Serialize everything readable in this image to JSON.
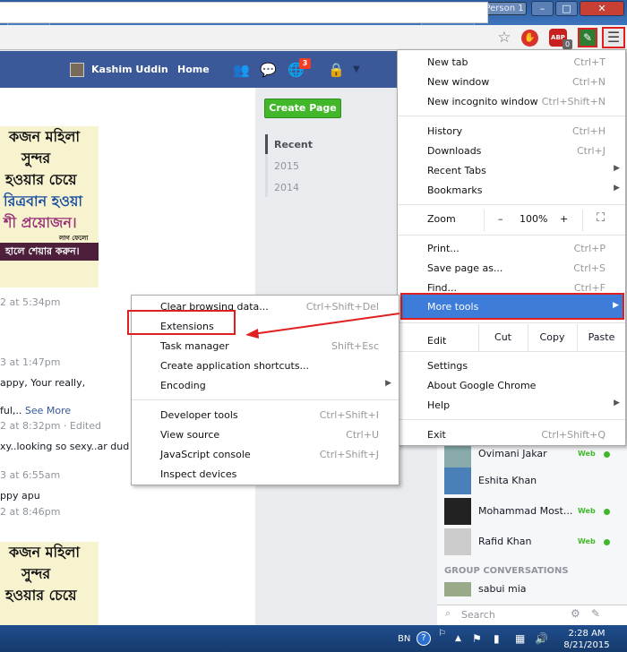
{
  "browser": {
    "profile_name": "Person 1",
    "window_controls": {
      "minimize": "–",
      "maximize": "□",
      "close": "✕"
    },
    "toolbar_icons": [
      "star-icon",
      "stop-extension-icon",
      "adblock-plus-icon",
      "green-extension-icon",
      "menu-icon"
    ],
    "abp_label": "ABP",
    "abp_badge": "0"
  },
  "facebook": {
    "user": "Kashim Uddin",
    "home": "Home",
    "notifications": "3",
    "create_page": "Create Page",
    "years": [
      "Recent",
      "2015",
      "2014"
    ],
    "banner_lines": [
      "কজন মহিলা",
      "সুন্দর",
      "হওয়ার চেয়ে",
      "রিত্রবান হওয়া",
      "শী প্রয়োজন।",
      "লাগ ফেলো",
      "হালে শেয়ার করুন।"
    ],
    "feed": [
      {
        "text": "2 at 5:34pm",
        "type": "time"
      },
      {
        "text": "3 at 1:47pm",
        "type": "time"
      },
      {
        "text": "appy, Your really,",
        "type": "text"
      },
      {
        "text": "ful,..",
        "type": "text",
        "link": "See More"
      },
      {
        "text": "2 at 8:32pm · Edited",
        "type": "time"
      },
      {
        "text": "xy..looking so sexy..ar dud b",
        "type": "text"
      },
      {
        "text": "3 at 6:55am",
        "type": "time"
      },
      {
        "text": "ppy apu",
        "type": "text"
      },
      {
        "text": "2 at 8:46pm",
        "type": "time"
      }
    ],
    "banner2_lines": [
      "কজন মহিলা",
      "সুন্দর",
      "হওয়ার চেয়ে"
    ],
    "chat": {
      "contacts": [
        {
          "name": "Ovimani Jakar",
          "status": "Web"
        },
        {
          "name": "Eshita Khan",
          "status": ""
        },
        {
          "name": "Mohammad Most...",
          "status": "Web"
        },
        {
          "name": "Rafid Khan",
          "status": "Web"
        }
      ],
      "group_header": "GROUP CONVERSATIONS",
      "group_name": "sabui mia",
      "search": "Search"
    }
  },
  "chrome_menu": {
    "items_top": [
      {
        "label": "New tab",
        "shortcut": "Ctrl+T"
      },
      {
        "label": "New window",
        "shortcut": "Ctrl+N"
      },
      {
        "label": "New incognito window",
        "shortcut": "Ctrl+Shift+N"
      }
    ],
    "items_history": [
      {
        "label": "History",
        "shortcut": "Ctrl+H"
      },
      {
        "label": "Downloads",
        "shortcut": "Ctrl+J"
      },
      {
        "label": "Recent Tabs",
        "shortcut": "▶"
      },
      {
        "label": "Bookmarks",
        "shortcut": "▶"
      }
    ],
    "zoom": {
      "label": "Zoom",
      "minus": "–",
      "value": "100%",
      "plus": "+",
      "fullscreen": "⛶"
    },
    "items_page": [
      {
        "label": "Print...",
        "shortcut": "Ctrl+P"
      },
      {
        "label": "Save page as...",
        "shortcut": "Ctrl+S"
      },
      {
        "label": "Find...",
        "shortcut": "Ctrl+F"
      }
    ],
    "more_tools": "More tools",
    "edit": {
      "label": "Edit",
      "cut": "Cut",
      "copy": "Copy",
      "paste": "Paste"
    },
    "items_settings": [
      {
        "label": "Settings",
        "shortcut": ""
      },
      {
        "label": "About Google Chrome",
        "shortcut": ""
      },
      {
        "label": "Help",
        "shortcut": "▶"
      }
    ],
    "exit": {
      "label": "Exit",
      "shortcut": "Ctrl+Shift+Q"
    }
  },
  "submenu": {
    "items_a": [
      {
        "label": "Clear browsing data...",
        "shortcut": "Ctrl+Shift+Del"
      },
      {
        "label": "Extensions",
        "shortcut": ""
      },
      {
        "label": "Task manager",
        "shortcut": "Shift+Esc"
      },
      {
        "label": "Create application shortcuts...",
        "shortcut": ""
      },
      {
        "label": "Encoding",
        "shortcut": "▶"
      }
    ],
    "items_b": [
      {
        "label": "Developer tools",
        "shortcut": "Ctrl+Shift+I"
      },
      {
        "label": "View source",
        "shortcut": "Ctrl+U"
      },
      {
        "label": "JavaScript console",
        "shortcut": "Ctrl+Shift+J"
      },
      {
        "label": "Inspect devices",
        "shortcut": ""
      }
    ]
  },
  "taskbar": {
    "lang": "BN",
    "time": "2:28 AM",
    "date": "8/21/2015"
  }
}
